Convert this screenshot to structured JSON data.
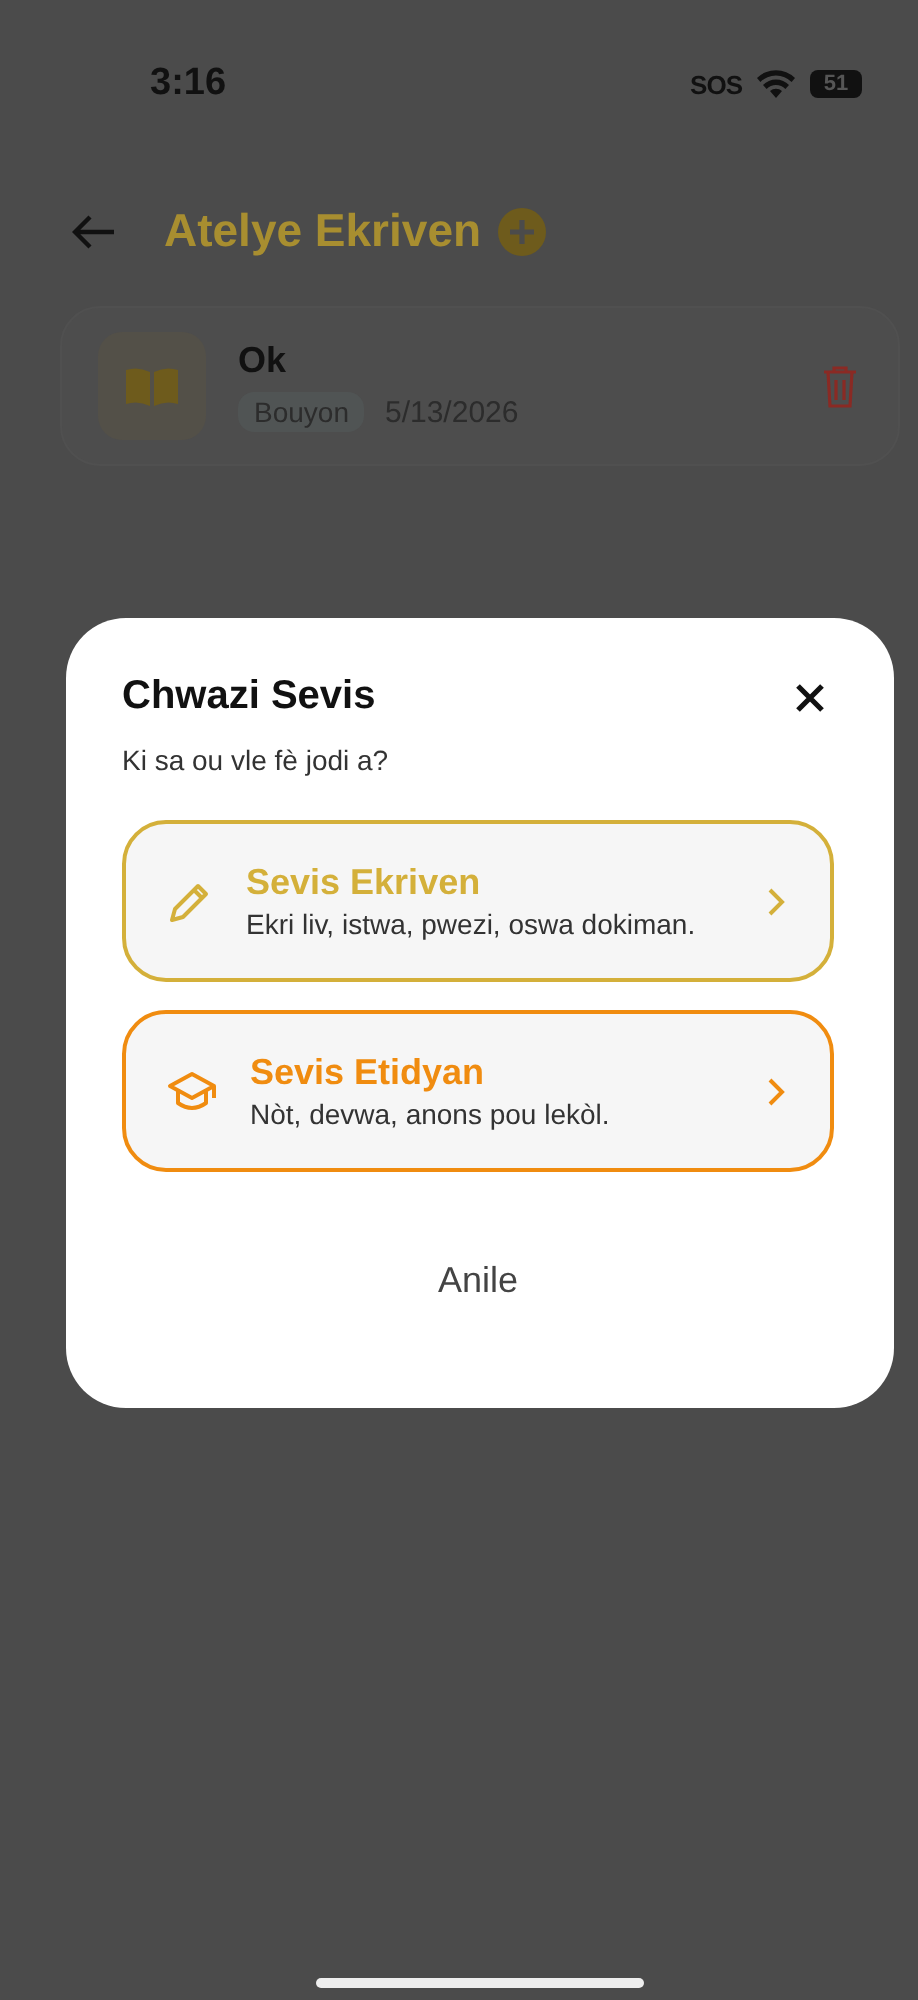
{
  "status_bar": {
    "time": "3:16",
    "sos": "SOS",
    "battery": "51"
  },
  "header": {
    "title": "Atelye Ekriven"
  },
  "items": [
    {
      "title": "Ok",
      "tag": "Bouyon",
      "date": "5/13/2026"
    }
  ],
  "dialog": {
    "title": "Chwazi Sevis",
    "subtitle": "Ki sa ou vle fè jodi a?",
    "options": [
      {
        "kind": "writing",
        "title": "Sevis Ekriven",
        "description": "Ekri liv, istwa, pwezi, oswa dokiman.",
        "color": "#d4b03a"
      },
      {
        "kind": "study",
        "title": "Sevis Etidyan",
        "description": "Nòt, devwa, anons pou lekòl.",
        "color": "#f08c10"
      }
    ],
    "cancel": "Anile"
  }
}
